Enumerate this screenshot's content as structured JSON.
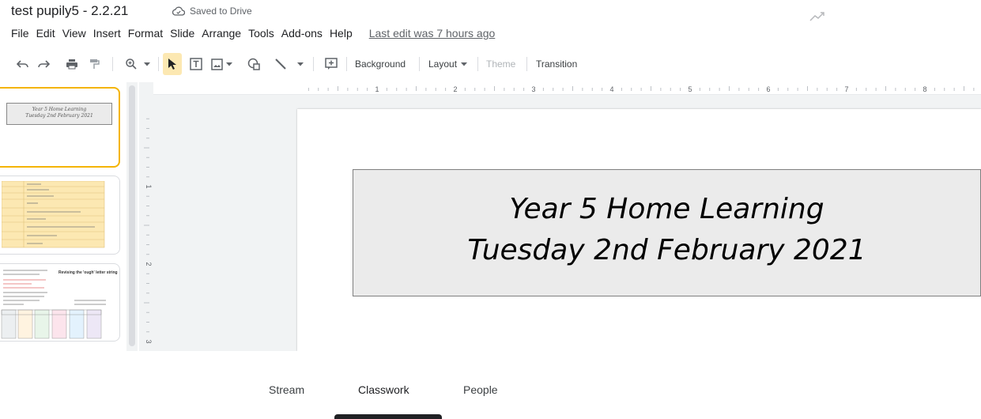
{
  "doc": {
    "title": "test pupily5 - 2.2.21",
    "saved_status": "Saved to Drive"
  },
  "menu": {
    "items": [
      "File",
      "Edit",
      "View",
      "Insert",
      "Format",
      "Slide",
      "Arrange",
      "Tools",
      "Add-ons",
      "Help"
    ],
    "last_edit": "Last edit was 7 hours ago"
  },
  "toolbar": {
    "background_label": "Background",
    "layout_label": "Layout",
    "theme_label": "Theme",
    "transition_label": "Transition"
  },
  "ruler": {
    "h_marks": [
      "1",
      "2",
      "3",
      "4",
      "5",
      "6",
      "7",
      "8"
    ],
    "v_marks": [
      "1",
      "2",
      "3"
    ]
  },
  "slide": {
    "title_line1": "Year 5 Home Learning",
    "title_line2": "Tuesday 2nd February 2021"
  },
  "thumbnails": {
    "slide1_line1": "Year 5 Home Learning",
    "slide1_line2": "Tuesday 2nd February 2021",
    "slide3_heading": "Revising the 'ough' letter string"
  },
  "classroom_tabs": {
    "stream": "Stream",
    "classwork": "Classwork",
    "people": "People",
    "active": "Classwork"
  },
  "colors": {
    "selected_thumb_border": "#f4b400",
    "timetable_fill": "#fce8b2",
    "title_box_fill": "#ebebeb",
    "link_gray": "#5f6368"
  }
}
